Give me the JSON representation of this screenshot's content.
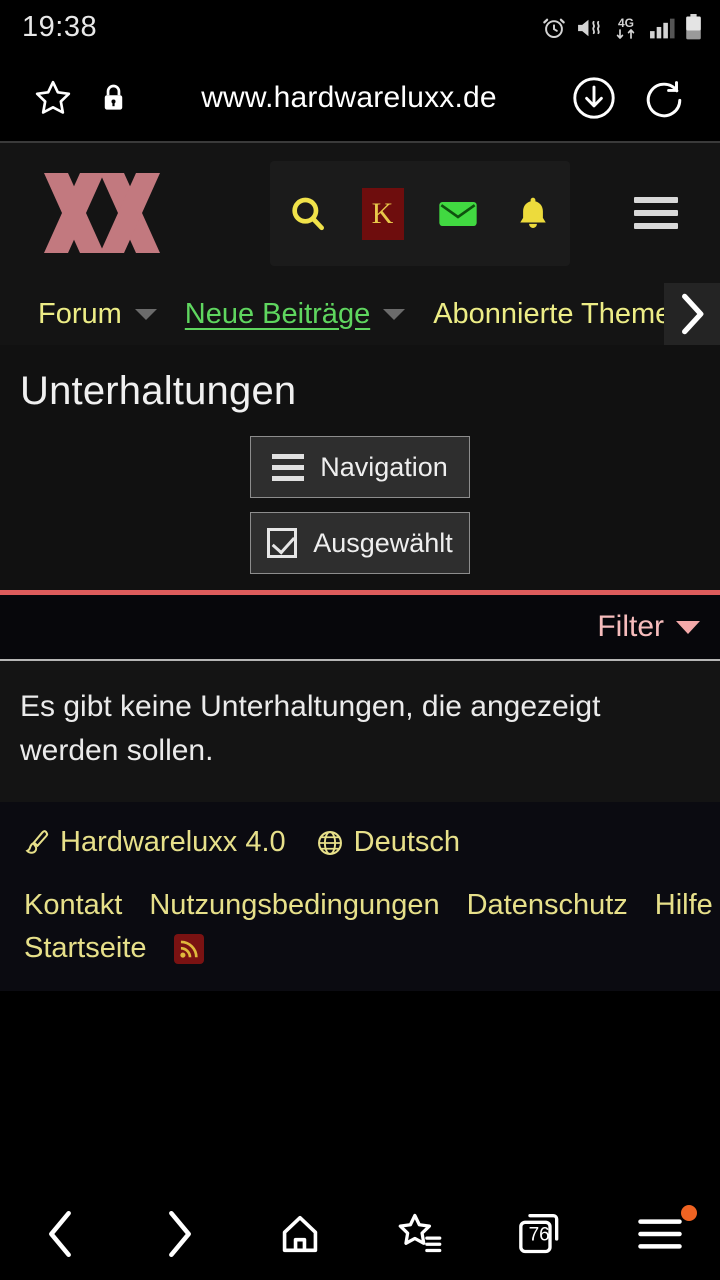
{
  "status_bar": {
    "time": "19:38",
    "network_label": "4G",
    "icons": [
      "alarm-icon",
      "vibrate-icon",
      "network-4g-icon",
      "signal-bars-icon",
      "battery-icon"
    ]
  },
  "browser": {
    "url": "www.hardwareluxx.de",
    "star_icon": "bookmark-star-icon",
    "lock_icon": "padlock-icon",
    "download_icon": "download-icon",
    "reload_icon": "reload-icon",
    "bottom_bar": {
      "back": "back-icon",
      "forward": "forward-icon",
      "home": "home-icon",
      "bookmarks": "bookmarks-icon",
      "tabs_count": "76",
      "menu": "menu-icon",
      "badge_color": "#ef6322"
    }
  },
  "site_header": {
    "logo_alt": "XX",
    "logo_color": "#c2797f",
    "actions": [
      {
        "name": "search-icon",
        "label": ""
      },
      {
        "name": "user-avatar",
        "label": "K"
      },
      {
        "name": "mail-icon",
        "label": ""
      },
      {
        "name": "bell-icon",
        "label": ""
      }
    ],
    "menu_icon": "hamburger-icon",
    "avatar_bg": "#6e0d0d",
    "avatar_fg": "#e8c84a"
  },
  "nav": {
    "items": [
      {
        "label": "Forum",
        "active": false,
        "has_caret": true
      },
      {
        "label": "Neue Beiträge",
        "active": true,
        "has_caret": true
      },
      {
        "label": "Abonnierte Themen",
        "active": false,
        "has_caret": true
      }
    ],
    "scroll_icon": "chevron-right-icon",
    "link_color": "#eded86",
    "active_color": "#5fd65f"
  },
  "page": {
    "title": "Unterhaltungen",
    "buttons": [
      {
        "label": "Navigation",
        "icon": "hamburger-icon"
      },
      {
        "label": "Ausgewählt",
        "icon": "checkbox-checked-icon"
      }
    ],
    "filter_label": "Filter",
    "filter_caret": "caret-down-icon",
    "empty_message": "Es gibt keine Unterhaltungen, die angezeigt werden sollen.",
    "accent_line_color": "#dd5c5c"
  },
  "footer": {
    "style_switcher": {
      "label": "Hardwareluxx 4.0",
      "icon": "paintbrush-icon"
    },
    "language": {
      "label": "Deutsch",
      "icon": "globe-icon"
    },
    "links": [
      "Kontakt",
      "Nutzungsbedingungen",
      "Datenschutz",
      "Hilfe",
      "Startseite"
    ],
    "rss_icon": "rss-icon",
    "link_color": "#e7e08a"
  }
}
